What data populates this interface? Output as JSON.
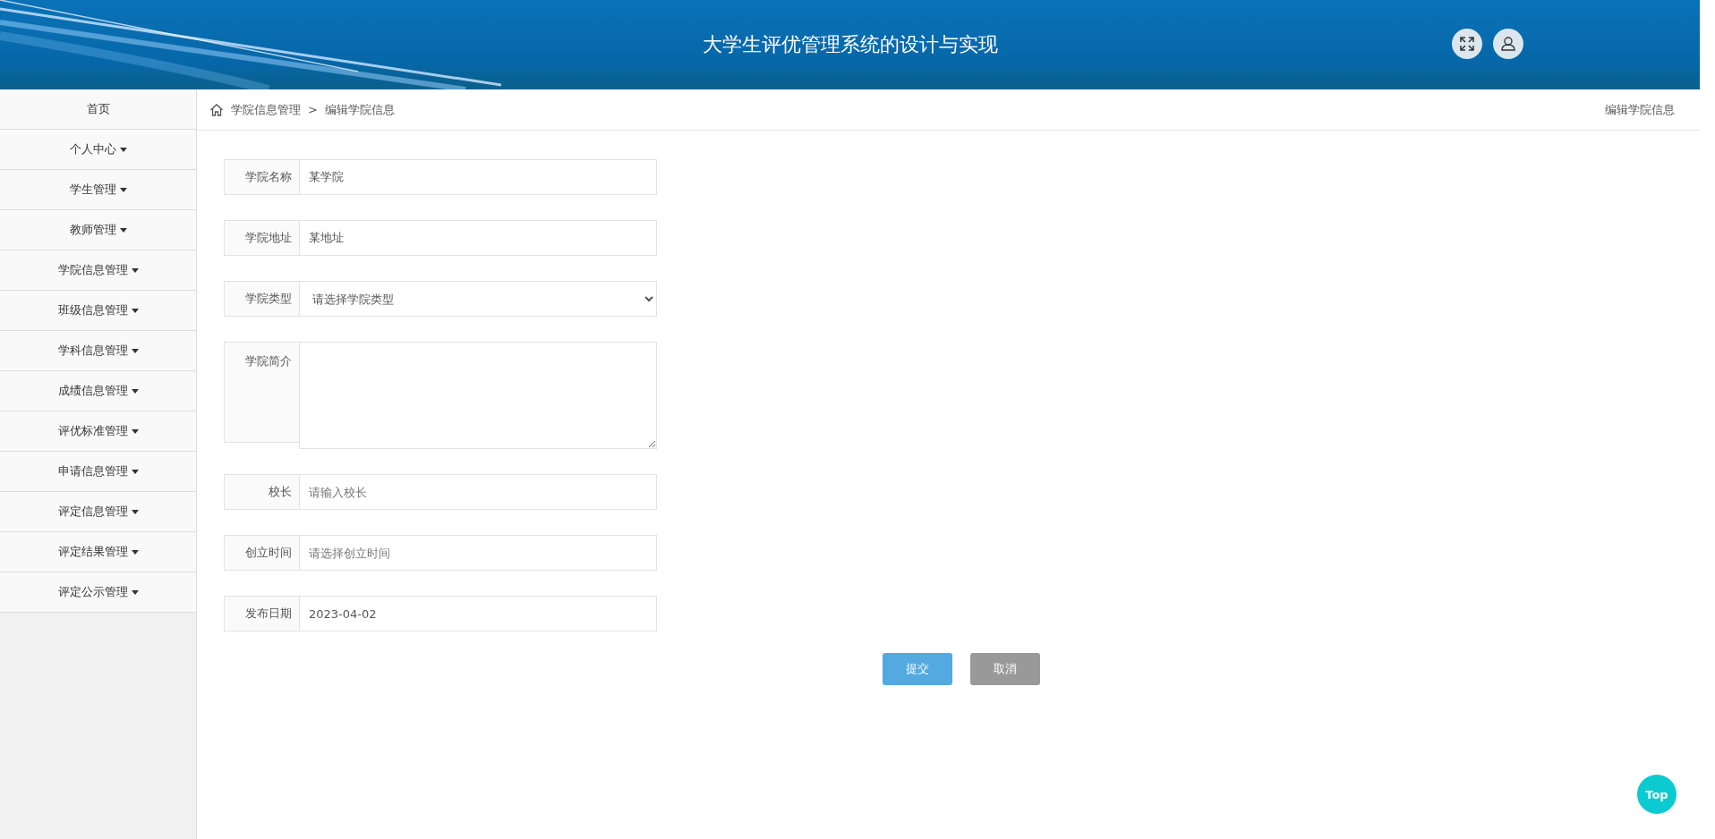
{
  "header": {
    "title": "大学生评优管理系统的设计与实现"
  },
  "sidebar": {
    "items": [
      {
        "label": "首页",
        "kind": "link"
      },
      {
        "label": "个人中心",
        "kind": "dropdown"
      },
      {
        "label": "学生管理",
        "kind": "dropdown"
      },
      {
        "label": "教师管理",
        "kind": "dropdown"
      },
      {
        "label": "学院信息管理",
        "kind": "dropdown"
      },
      {
        "label": "班级信息管理",
        "kind": "dropdown"
      },
      {
        "label": "学科信息管理",
        "kind": "dropdown"
      },
      {
        "label": "成绩信息管理",
        "kind": "dropdown"
      },
      {
        "label": "评优标准管理",
        "kind": "dropdown"
      },
      {
        "label": "申请信息管理",
        "kind": "dropdown"
      },
      {
        "label": "评定信息管理",
        "kind": "dropdown"
      },
      {
        "label": "评定结果管理",
        "kind": "dropdown"
      },
      {
        "label": "评定公示管理",
        "kind": "dropdown"
      }
    ]
  },
  "breadcrumb": {
    "items": [
      "学院信息管理",
      "编辑学院信息"
    ],
    "separator": ">",
    "page_title": "编辑学院信息"
  },
  "form": {
    "fields": [
      {
        "label": "学院名称",
        "kind": "text",
        "value": "某学院"
      },
      {
        "label": "学院地址",
        "kind": "text",
        "value": "某地址"
      },
      {
        "label": "学院类型",
        "kind": "select",
        "value": "请选择学院类型"
      },
      {
        "label": "学院简介",
        "kind": "textarea"
      },
      {
        "label": "校长",
        "kind": "text",
        "placeholder": "请输入校长"
      },
      {
        "label": "创立时间",
        "kind": "text",
        "placeholder": "请选择创立时间"
      },
      {
        "label": "发布日期",
        "kind": "text",
        "value": "2023-04-02"
      }
    ],
    "buttons": [
      {
        "label": "提交",
        "kind": "primary"
      },
      {
        "label": "取消",
        "kind": "secondary"
      }
    ]
  },
  "back_to_top": {
    "label": "Top"
  }
}
